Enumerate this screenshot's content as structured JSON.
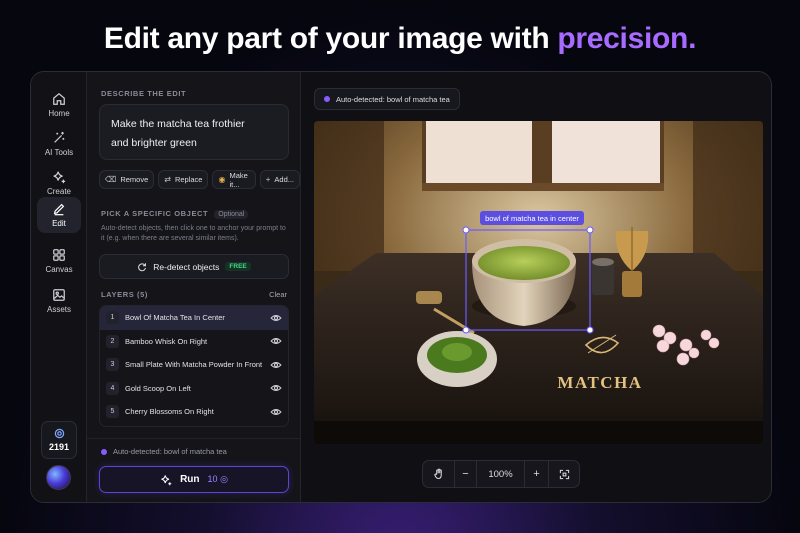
{
  "headline": {
    "main": "Edit any part of your image with ",
    "accent": "precision."
  },
  "nav": {
    "items": [
      {
        "label": "Home",
        "icon": "home-icon"
      },
      {
        "label": "AI Tools",
        "icon": "magic-wand-icon"
      },
      {
        "label": "Create",
        "icon": "sparkle-icon"
      },
      {
        "label": "Edit",
        "icon": "pencil-icon"
      },
      {
        "label": "Canvas",
        "icon": "grid-icon"
      },
      {
        "label": "Assets",
        "icon": "image-icon"
      }
    ],
    "active": "Edit",
    "credits": "2191"
  },
  "edit_panel": {
    "describe_label": "DESCRIBE THE EDIT",
    "prompt": "Make the matcha tea frothier\nand brighter green",
    "chips": [
      {
        "label": "Remove",
        "icon": "eraser-icon"
      },
      {
        "label": "Replace",
        "icon": "replace-icon"
      },
      {
        "label": "Make it...",
        "icon": "palette-icon"
      },
      {
        "label": "Add...",
        "icon": "plus-icon"
      }
    ],
    "pick_label": "PICK A SPECIFIC OBJECT",
    "optional_badge": "Optional",
    "hint": "Auto-detect objects, then click one to anchor your prompt to it (e.g. when there are several similar items).",
    "redetect_label": "Re-detect objects",
    "free_badge": "FREE",
    "layers_label": "LAYERS (5)",
    "clear_label": "Clear",
    "layers": [
      {
        "num": "1",
        "name": "Bowl Of Matcha Tea In Center",
        "selected": true
      },
      {
        "num": "2",
        "name": "Bamboo Whisk On Right",
        "selected": false
      },
      {
        "num": "3",
        "name": "Small Plate With Matcha Powder In Front",
        "selected": false
      },
      {
        "num": "4",
        "name": "Gold Scoop On Left",
        "selected": false
      },
      {
        "num": "5",
        "name": "Cherry Blossoms On Right",
        "selected": false
      }
    ],
    "auto_detected": "Auto-detected: bowl of matcha tea",
    "run_label": "Run",
    "run_cost": "10"
  },
  "canvas": {
    "auto_detected": "Auto-detected: bowl of matcha tea",
    "selection_label": "bowl of matcha tea in center",
    "board_text": "MATCHA",
    "zoom": "100%"
  },
  "colors": {
    "accent": "#a86bff",
    "selection": "#6a5cff",
    "run_border": "#5b44d6"
  }
}
